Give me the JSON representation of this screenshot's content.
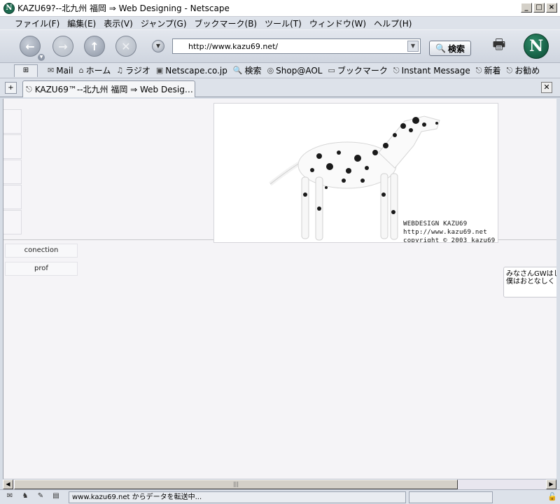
{
  "window": {
    "title": "KAZU69?--北九州 福岡 ⇒ Web Designing - Netscape",
    "minimize": "_",
    "maximize": "□",
    "close": "×"
  },
  "menu": [
    "ファイル(F)",
    "編集(E)",
    "表示(V)",
    "ジャンプ(G)",
    "ブックマーク(B)",
    "ツール(T)",
    "ウィンドウ(W)",
    "ヘルプ(H)"
  ],
  "nav": {
    "url": "http://www.kazu69.net/",
    "search_label": "検索",
    "logo_letter": "N"
  },
  "personal_toolbar": [
    "Mail",
    "ホーム",
    "ラジオ",
    "Netscape.co.jp",
    "検索",
    "Shop@AOL",
    "ブックマーク",
    "Instant Message",
    "新着",
    "お勧め"
  ],
  "tab": {
    "label": "KAZU69™--北九州 福岡 ⇒ Web Designi..."
  },
  "page": {
    "hero_lines": [
      "WEBDESIGN KAZU69",
      "http://www.kazu69.net",
      "copyright © 2003 kazu69"
    ],
    "buttons": [
      "conection",
      "prof"
    ],
    "news_lines": [
      "みなさんGWはし",
      "僕はおとなしく"
    ]
  },
  "status": {
    "text": "www.kazu69.net からデータを転送中..."
  }
}
